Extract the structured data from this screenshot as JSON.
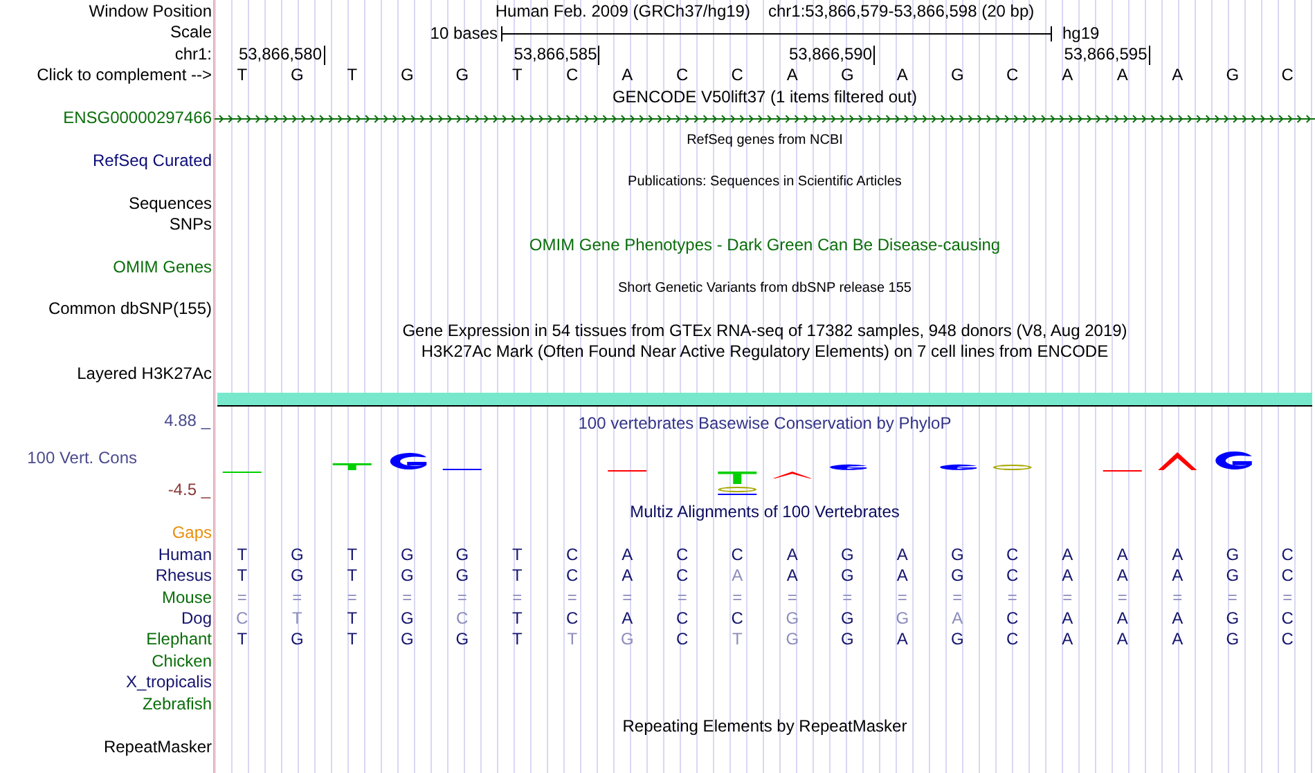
{
  "header": {
    "label": "Window Position",
    "assembly": "Human Feb. 2009 (GRCh37/hg19)",
    "range": "chr1:53,866,579-53,866,598 (20 bp)"
  },
  "scale": {
    "label": "Scale",
    "span": "10 bases",
    "assembly": "hg19"
  },
  "ruler": {
    "label": "chr1:",
    "ticks": [
      "53,866,580",
      "53,866,585",
      "53,866,590",
      "53,866,595"
    ]
  },
  "sequence": {
    "label": "Click to complement -->",
    "bases": [
      "T",
      "G",
      "T",
      "G",
      "G",
      "T",
      "C",
      "A",
      "C",
      "C",
      "A",
      "G",
      "A",
      "G",
      "C",
      "A",
      "A",
      "A",
      "G",
      "C"
    ]
  },
  "tracks": [
    {
      "kind": "title",
      "text": "GENCODE V50lift37 (1 items filtered out)"
    },
    {
      "kind": "gene",
      "label": "ENSG00000297466",
      "color": "#0a6e0a"
    },
    {
      "kind": "small-title",
      "text": "RefSeq genes from NCBI"
    },
    {
      "kind": "label",
      "label": "RefSeq Curated",
      "color": "#0c0c78"
    },
    {
      "kind": "small-title",
      "text": "Publications: Sequences in Scientific Articles"
    },
    {
      "kind": "label",
      "label": "Sequences",
      "color": "#000000"
    },
    {
      "kind": "label",
      "label": "SNPs",
      "color": "#000000"
    },
    {
      "kind": "title",
      "text": "OMIM Gene Phenotypes - Dark Green Can Be Disease-causing",
      "color": "#0a6e0a"
    },
    {
      "kind": "label",
      "label": "OMIM Genes",
      "color": "#0a6e0a"
    },
    {
      "kind": "small-title",
      "text": "Short Genetic Variants from dbSNP release 155"
    },
    {
      "kind": "label",
      "label": "Common dbSNP(155)",
      "color": "#000000"
    },
    {
      "kind": "title",
      "text": "Gene Expression in 54 tissues from GTEx RNA-seq of 17382 samples, 948 donors (V8, Aug 2019)"
    },
    {
      "kind": "title",
      "text": "H3K27Ac Mark (Often Found Near Active Regulatory Elements) on 7 cell lines from ENCODE"
    },
    {
      "kind": "label",
      "label": "Layered H3K27Ac",
      "color": "#000000"
    },
    {
      "kind": "signal"
    }
  ],
  "conservation": {
    "title": "100 vertebrates Basewise Conservation by PhyloP",
    "label": "100 Vert. Cons",
    "max": "4.88 _",
    "min": "-4.5 _"
  },
  "multiz": {
    "title": "Multiz Alignments of 100 Vertebrates",
    "gaps_label": "Gaps",
    "species": [
      {
        "name": "Human",
        "color": "#14146e",
        "bases": [
          {
            "b": "T",
            "m": true
          },
          {
            "b": "G",
            "m": true
          },
          {
            "b": "T",
            "m": true
          },
          {
            "b": "G",
            "m": true
          },
          {
            "b": "G",
            "m": true
          },
          {
            "b": "T",
            "m": true
          },
          {
            "b": "C",
            "m": true
          },
          {
            "b": "A",
            "m": true
          },
          {
            "b": "C",
            "m": true
          },
          {
            "b": "C",
            "m": true
          },
          {
            "b": "A",
            "m": true
          },
          {
            "b": "G",
            "m": true
          },
          {
            "b": "A",
            "m": true
          },
          {
            "b": "G",
            "m": true
          },
          {
            "b": "C",
            "m": true
          },
          {
            "b": "A",
            "m": true
          },
          {
            "b": "A",
            "m": true
          },
          {
            "b": "A",
            "m": true
          },
          {
            "b": "G",
            "m": true
          },
          {
            "b": "C",
            "m": true
          }
        ]
      },
      {
        "name": "Rhesus",
        "color": "#14146e",
        "bases": [
          {
            "b": "T",
            "m": true
          },
          {
            "b": "G",
            "m": true
          },
          {
            "b": "T",
            "m": true
          },
          {
            "b": "G",
            "m": true
          },
          {
            "b": "G",
            "m": true
          },
          {
            "b": "T",
            "m": true
          },
          {
            "b": "C",
            "m": true
          },
          {
            "b": "A",
            "m": true
          },
          {
            "b": "C",
            "m": true
          },
          {
            "b": "A",
            "m": false
          },
          {
            "b": "A",
            "m": true
          },
          {
            "b": "G",
            "m": true
          },
          {
            "b": "A",
            "m": true
          },
          {
            "b": "G",
            "m": true
          },
          {
            "b": "C",
            "m": true
          },
          {
            "b": "A",
            "m": true
          },
          {
            "b": "A",
            "m": true
          },
          {
            "b": "A",
            "m": true
          },
          {
            "b": "G",
            "m": true
          },
          {
            "b": "C",
            "m": true
          }
        ]
      },
      {
        "name": "Mouse",
        "color": "#0a6e0a",
        "bases": [
          {
            "b": "=",
            "m": false
          },
          {
            "b": "=",
            "m": false
          },
          {
            "b": "=",
            "m": false
          },
          {
            "b": "=",
            "m": false
          },
          {
            "b": "=",
            "m": false
          },
          {
            "b": "=",
            "m": false
          },
          {
            "b": "=",
            "m": false
          },
          {
            "b": "=",
            "m": false
          },
          {
            "b": "=",
            "m": false
          },
          {
            "b": "=",
            "m": false
          },
          {
            "b": "=",
            "m": false
          },
          {
            "b": "=",
            "m": false
          },
          {
            "b": "=",
            "m": false
          },
          {
            "b": "=",
            "m": false
          },
          {
            "b": "=",
            "m": false
          },
          {
            "b": "=",
            "m": false
          },
          {
            "b": "=",
            "m": false
          },
          {
            "b": "=",
            "m": false
          },
          {
            "b": "=",
            "m": false
          },
          {
            "b": "=",
            "m": false
          }
        ]
      },
      {
        "name": "Dog",
        "color": "#14146e",
        "bases": [
          {
            "b": "C",
            "m": false
          },
          {
            "b": "T",
            "m": false
          },
          {
            "b": "T",
            "m": true
          },
          {
            "b": "G",
            "m": true
          },
          {
            "b": "C",
            "m": false
          },
          {
            "b": "T",
            "m": true
          },
          {
            "b": "C",
            "m": true
          },
          {
            "b": "A",
            "m": true
          },
          {
            "b": "C",
            "m": true
          },
          {
            "b": "C",
            "m": true
          },
          {
            "b": "G",
            "m": false
          },
          {
            "b": "G",
            "m": true
          },
          {
            "b": "G",
            "m": false
          },
          {
            "b": "A",
            "m": false
          },
          {
            "b": "C",
            "m": true
          },
          {
            "b": "A",
            "m": true
          },
          {
            "b": "A",
            "m": true
          },
          {
            "b": "A",
            "m": true
          },
          {
            "b": "G",
            "m": true
          },
          {
            "b": "C",
            "m": true
          }
        ]
      },
      {
        "name": "Elephant",
        "color": "#0a6e0a",
        "bases": [
          {
            "b": "T",
            "m": true
          },
          {
            "b": "G",
            "m": true
          },
          {
            "b": "T",
            "m": true
          },
          {
            "b": "G",
            "m": true
          },
          {
            "b": "G",
            "m": true
          },
          {
            "b": "T",
            "m": true
          },
          {
            "b": "T",
            "m": false
          },
          {
            "b": "G",
            "m": false
          },
          {
            "b": "C",
            "m": true
          },
          {
            "b": "T",
            "m": false
          },
          {
            "b": "G",
            "m": false
          },
          {
            "b": "G",
            "m": true
          },
          {
            "b": "A",
            "m": true
          },
          {
            "b": "G",
            "m": true
          },
          {
            "b": "C",
            "m": true
          },
          {
            "b": "A",
            "m": true
          },
          {
            "b": "A",
            "m": true
          },
          {
            "b": "A",
            "m": true
          },
          {
            "b": "G",
            "m": true
          },
          {
            "b": "C",
            "m": true
          }
        ]
      },
      {
        "name": "Chicken",
        "color": "#0a6e0a"
      },
      {
        "name": "X_tropicalis",
        "color": "#14146e"
      },
      {
        "name": "Zebrafish",
        "color": "#0a6e0a"
      }
    ]
  },
  "repeats": {
    "title": "Repeating Elements by RepeatMasker",
    "label": "RepeatMasker"
  }
}
